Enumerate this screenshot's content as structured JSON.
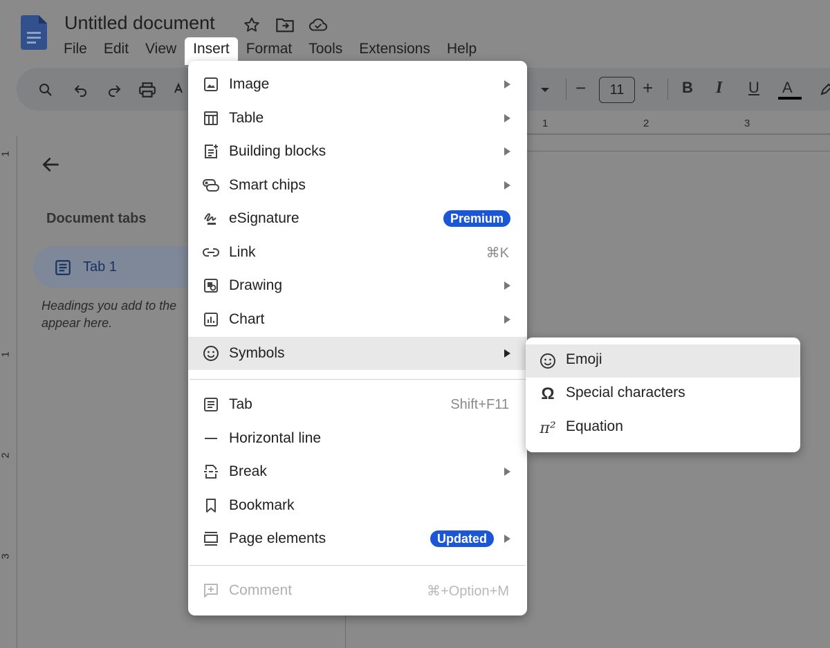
{
  "document": {
    "title": "Untitled document"
  },
  "menubar": {
    "items": [
      "File",
      "Edit",
      "View",
      "Insert",
      "Format",
      "Tools",
      "Extensions",
      "Help"
    ],
    "active": "Insert"
  },
  "toolbar": {
    "font_size": "11",
    "decrease_label": "−",
    "increase_label": "+",
    "bold_label": "B",
    "italic_label": "I",
    "underline_label": "U",
    "text_color_label": "A"
  },
  "ruler": {
    "horizontal_marks": [
      "1",
      "2",
      "3"
    ],
    "vertical_marks": [
      "1",
      "1",
      "2",
      "3"
    ]
  },
  "sidebar": {
    "title": "Document tabs",
    "tab_label": "Tab 1",
    "hint": "Headings you add to the document will appear here.",
    "hint_visible": "Headings you add to the\nappear here."
  },
  "insert_menu": {
    "items": [
      {
        "label": "Image",
        "icon": "image-icon",
        "submenu": true
      },
      {
        "label": "Table",
        "icon": "table-icon",
        "submenu": true
      },
      {
        "label": "Building blocks",
        "icon": "building-blocks-icon",
        "submenu": true
      },
      {
        "label": "Smart chips",
        "icon": "smart-chips-icon",
        "submenu": true
      },
      {
        "label": "eSignature",
        "icon": "signature-icon",
        "badge": "Premium"
      },
      {
        "label": "Link",
        "icon": "link-icon",
        "shortcut": "⌘K"
      },
      {
        "label": "Drawing",
        "icon": "drawing-icon",
        "submenu": true
      },
      {
        "label": "Chart",
        "icon": "chart-icon",
        "submenu": true
      },
      {
        "label": "Symbols",
        "icon": "emoji-icon",
        "submenu": true,
        "highlighted": true
      },
      {
        "label": "Tab",
        "icon": "tab-icon",
        "shortcut": "Shift+F11"
      },
      {
        "label": "Horizontal line",
        "icon": "horizontal-line-icon"
      },
      {
        "label": "Break",
        "icon": "break-icon",
        "submenu": true
      },
      {
        "label": "Bookmark",
        "icon": "bookmark-icon"
      },
      {
        "label": "Page elements",
        "icon": "page-elements-icon",
        "badge": "Updated",
        "submenu": true
      },
      {
        "label": "Comment",
        "icon": "add-comment-icon",
        "shortcut": "⌘+Option+M",
        "disabled": true
      }
    ]
  },
  "symbols_submenu": {
    "items": [
      {
        "label": "Emoji",
        "icon": "emoji-icon",
        "highlighted": true
      },
      {
        "label": "Special characters",
        "icon": "omega-icon",
        "glyph": "Ω"
      },
      {
        "label": "Equation",
        "icon": "pi-icon",
        "glyph": "π²"
      }
    ]
  },
  "colors": {
    "badge_blue": "#1a56d6",
    "overlay_gray": "#8a8a8a",
    "highlight": "#e8e8e8"
  }
}
